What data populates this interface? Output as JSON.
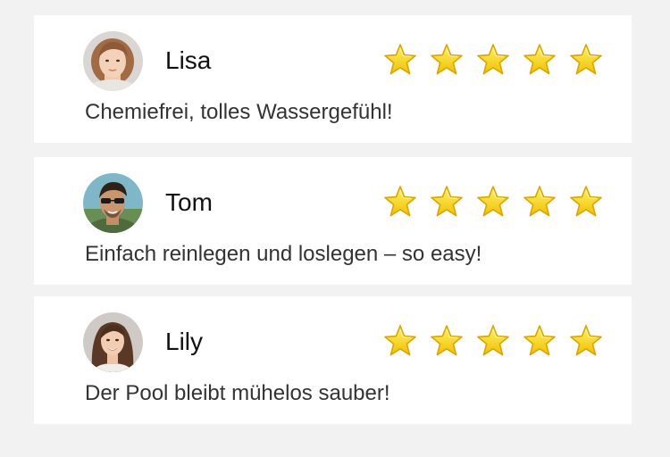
{
  "reviews": [
    {
      "name": "Lisa",
      "text": "Chemiefrei, tolles Wassergefühl!",
      "rating": 5,
      "avatar": "woman-short-hair-avatar"
    },
    {
      "name": "Tom",
      "text": "Einfach reinlegen und loslegen – so easy!",
      "rating": 5,
      "avatar": "man-sunglasses-avatar"
    },
    {
      "name": "Lily",
      "text": "Der Pool bleibt mühelos sauber!",
      "rating": 5,
      "avatar": "woman-long-hair-avatar"
    }
  ],
  "colors": {
    "star_fill_top": "#fff06a",
    "star_fill_bottom": "#f2c400",
    "star_outline": "#d9a600",
    "card_background": "#ffffff",
    "page_background": "#f2f2f2"
  },
  "icons": {
    "rating": "star-icon"
  }
}
